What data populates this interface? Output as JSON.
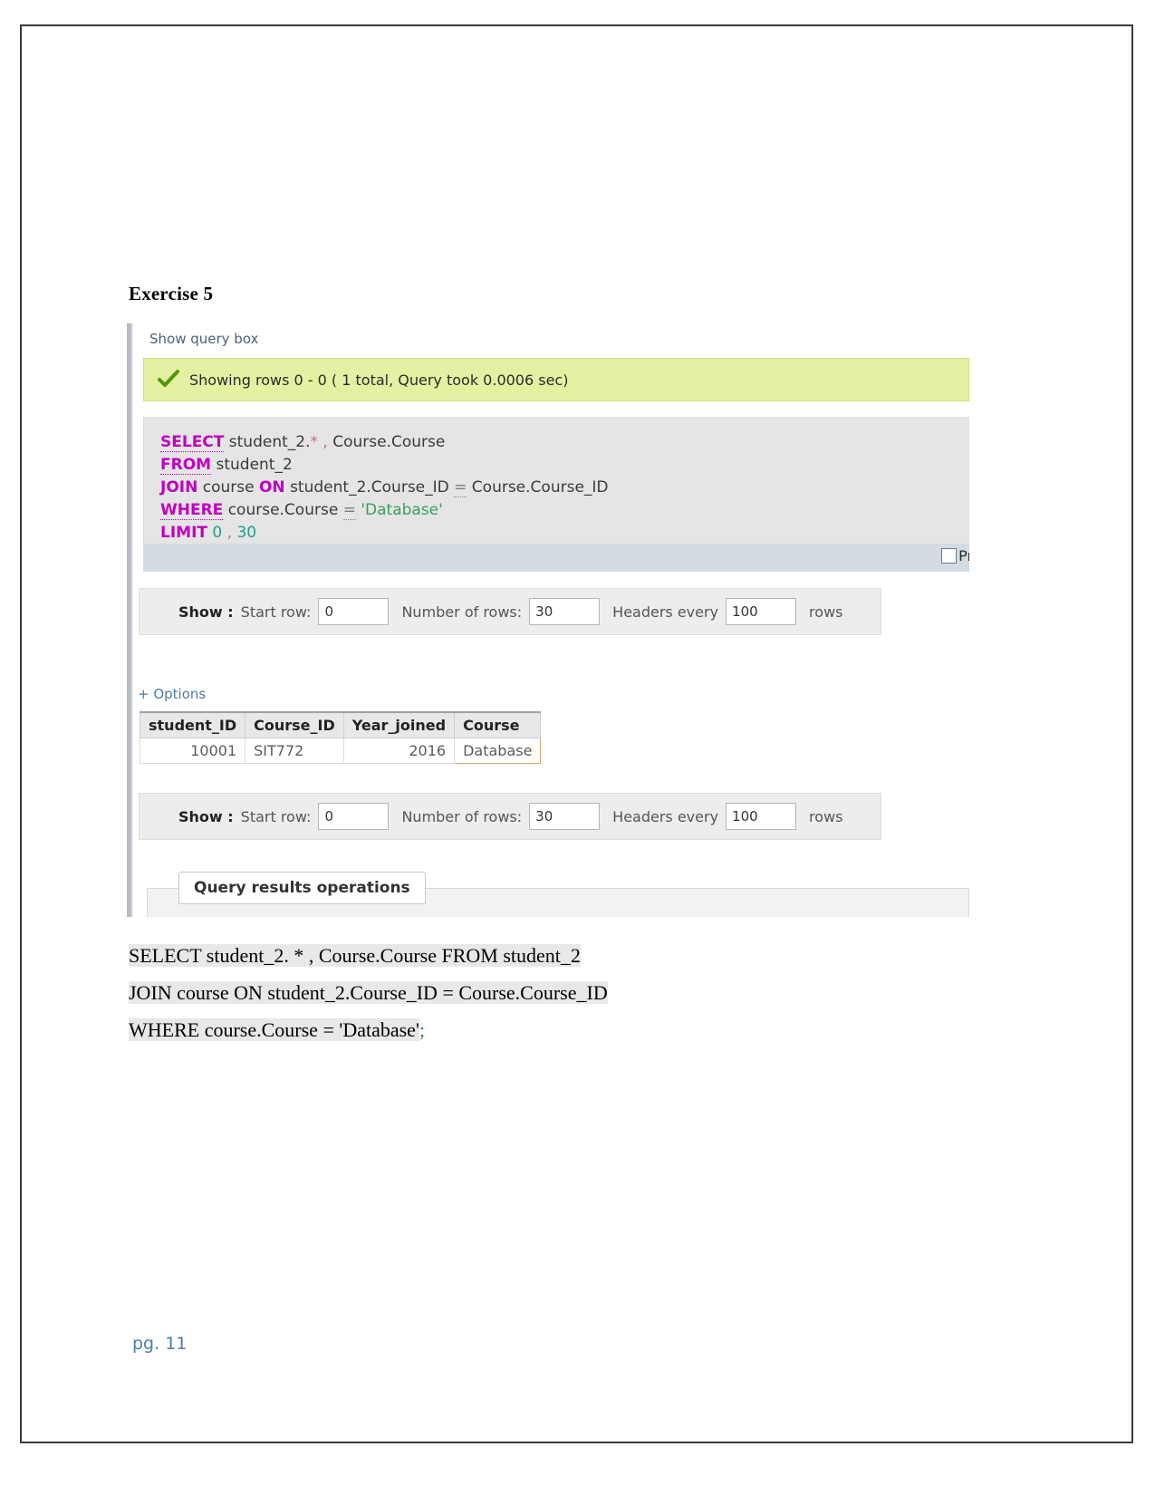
{
  "document": {
    "heading": "Exercise 5",
    "footer_page": "pg. 11"
  },
  "screenshot": {
    "show_query_box_link": "Show query box",
    "status": {
      "icon": "success-check-icon",
      "text": "Showing rows 0 - 0 ( 1 total, Query took 0.0006 sec)"
    },
    "sql": {
      "line1": {
        "kw": "SELECT",
        "rest_a": " student_2.",
        "star": "*",
        "comma": " , ",
        "rest_b": "Course.Course"
      },
      "line2": {
        "kw": "FROM",
        "rest": " student_2"
      },
      "line3": {
        "kw": "JOIN",
        "mid_a": " course ",
        "kw2": "ON",
        "mid_b": " student_2.Course_ID ",
        "op": "=",
        "mid_c": " Course.Course_ID"
      },
      "line4": {
        "kw": "WHERE",
        "mid_a": " course.Course ",
        "op": "=",
        "mid_b": " ",
        "str": "'Database'"
      },
      "line5": {
        "kw": "LIMIT",
        "n1": " 0",
        "comma": " , ",
        "n2": "30"
      }
    },
    "profiling": {
      "label": "Profil",
      "checked": false
    },
    "show_bar_top": {
      "show_label": "Show :",
      "start_row_label": "Start row:",
      "start_row_value": "0",
      "number_of_rows_label": "Number of rows:",
      "number_of_rows_value": "30",
      "headers_every_label": "Headers every",
      "headers_every_value": "100",
      "rows_label": "rows"
    },
    "show_bar_bottom": {
      "show_label": "Show :",
      "start_row_label": "Start row:",
      "start_row_value": "0",
      "number_of_rows_label": "Number of rows:",
      "number_of_rows_value": "30",
      "headers_every_label": "Headers every",
      "headers_every_value": "100",
      "rows_label": "rows"
    },
    "options_link": "+ Options",
    "results": {
      "columns": [
        "student_ID",
        "Course_ID",
        "Year_joined",
        "Course"
      ],
      "rows": [
        {
          "student_ID": "10001",
          "Course_ID": "SIT772",
          "Year_joined": "2016",
          "Course": "Database"
        }
      ]
    },
    "query_results_operations_tab": "Query results operations"
  },
  "sql_text": {
    "line1_a": "SELECT student_2. * , Course.Course",
    "line1_b": " FROM student_2",
    "line2_a": "JOIN course ON student_2.Course_ID",
    "line2_b": " = Course.Course_ID",
    "line3_a": "WHERE course.Course = 'Database'",
    "line3_semi": ";"
  },
  "colors": {
    "keyword": "#c000c0",
    "string": "#3aa05a",
    "number": "#1f9e8e",
    "success_bg": "#e6f0a3",
    "profiling_bg": "#d3dce3",
    "link": "#4c7ba6"
  }
}
